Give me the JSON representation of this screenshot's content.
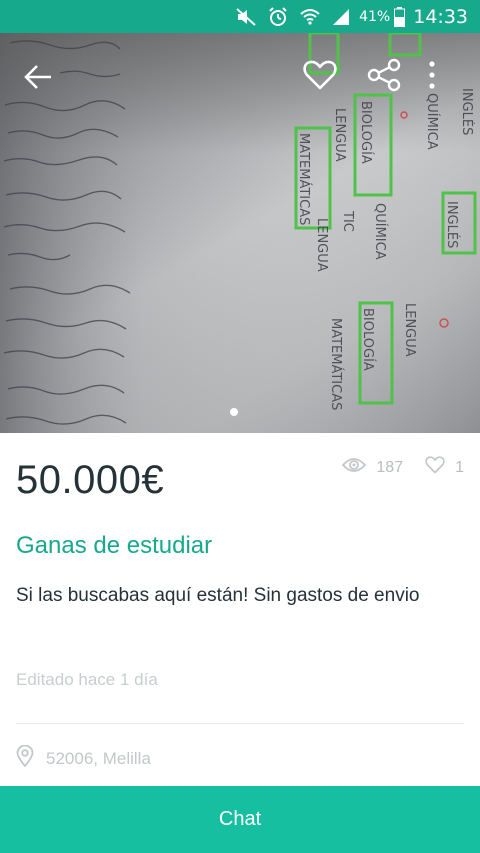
{
  "status_bar": {
    "battery_percent": "41%",
    "time": "14:33",
    "icons": [
      "mute-icon",
      "alarm-icon",
      "wifi-icon",
      "signal-icon",
      "battery-icon"
    ]
  },
  "toolbar": {
    "icons": [
      "back-arrow-icon",
      "heart-icon",
      "share-icon",
      "more-vert-icon"
    ]
  },
  "product": {
    "price": "50.000€",
    "views": "187",
    "favorites": "1",
    "title": "Ganas de estudiar",
    "description": "Si las buscabas aquí están! Sin gastos de envio",
    "edited": "Editado hace 1 día",
    "location": "52006, Melilla"
  },
  "photo": {
    "pager_pages": 1,
    "pager_current": 1
  },
  "actions": {
    "chat_label": "Chat"
  },
  "colors": {
    "accent": "#17a98c",
    "chat_button": "#17bfa1",
    "text_dark": "#253238",
    "muted": "#c3c7ca"
  }
}
